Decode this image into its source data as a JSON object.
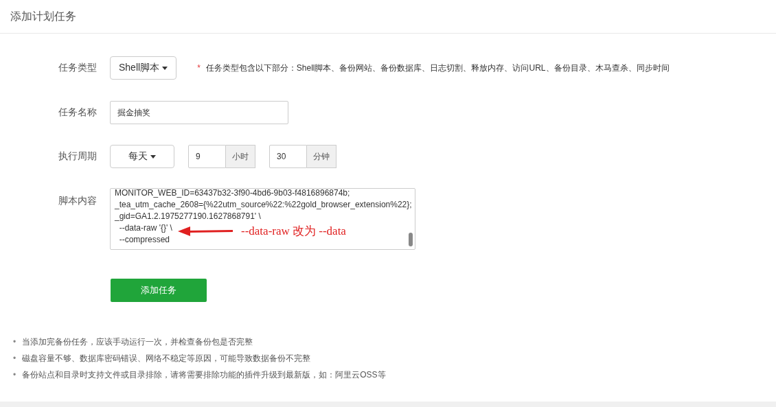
{
  "header": {
    "title": "添加计划任务"
  },
  "form": {
    "task_type": {
      "label": "任务类型",
      "value": "Shell脚本",
      "required_mark": "*",
      "hint": "任务类型包含以下部分：Shell脚本、备份网站、备份数据库、日志切割、释放内存、访问URL、备份目录、木马查杀、同步时间"
    },
    "task_name": {
      "label": "任务名称",
      "value": "掘金抽奖"
    },
    "period": {
      "label": "执行周期",
      "frequency": "每天",
      "hour": "9",
      "hour_unit": "小时",
      "minute": "30",
      "minute_unit": "分钟"
    },
    "script": {
      "label": "脚本内容",
      "lines": [
        "MONITOR_WEB_ID=63437b32-3f90-4bd6-9b03-f4816896874b;",
        "_tea_utm_cache_2608={%22utm_source%22:%22gold_browser_extension%22};",
        "_gid=GA1.2.1975277190.1627868791' \\",
        "  --data-raw '{}' \\",
        "  --compressed"
      ],
      "annotation": "--data-raw 改为 --data"
    },
    "submit": "添加任务"
  },
  "notes": [
    {
      "bullet": "•",
      "text": "当添加完备份任务，应该手动运行一次，并检查备份包是否完整"
    },
    {
      "bullet": "•",
      "text": "磁盘容量不够、数据库密码错误、网络不稳定等原因，可能导致数据备份不完整"
    },
    {
      "bullet": "•",
      "text": "备份站点和目录时支持文件或目录排除，请将需要排除功能的插件升级到最新版，如：阿里云OSS等"
    }
  ]
}
